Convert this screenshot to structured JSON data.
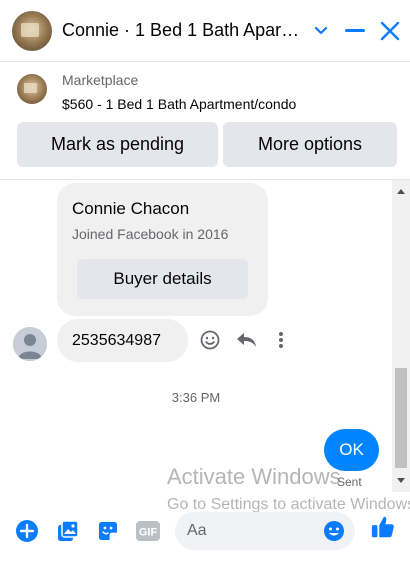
{
  "header": {
    "title": "Connie · 1 Bed 1 Bath Apar…",
    "icons": {
      "avatar": "listing-photo",
      "dropdown": "chevron-down-icon",
      "minimize": "minimize-icon",
      "close": "close-icon"
    }
  },
  "listing": {
    "source": "Marketplace",
    "description": "$560 - 1 Bed 1 Bath Apartment/condo",
    "pending_button": "Mark as pending",
    "more_button": "More options"
  },
  "messages": {
    "card": {
      "name": "Connie Chacon",
      "joined": "Joined Facebook in 2016",
      "buyer_button": "Buyer details"
    },
    "received": "2535634987",
    "timestamp": "3:36 PM",
    "sent_message": "OK",
    "sent_status": "Sent"
  },
  "watermark": {
    "line1": "Activate Windows",
    "line2": "Go to Settings to activate Windows."
  },
  "composer": {
    "placeholder": "Aa",
    "gif_label": "GIF"
  },
  "colors": {
    "accent": "#0a7cff",
    "bubble_sent": "#0084ff",
    "bubble_received": "#f0f0f0",
    "button_bg": "#e4e6eb"
  }
}
